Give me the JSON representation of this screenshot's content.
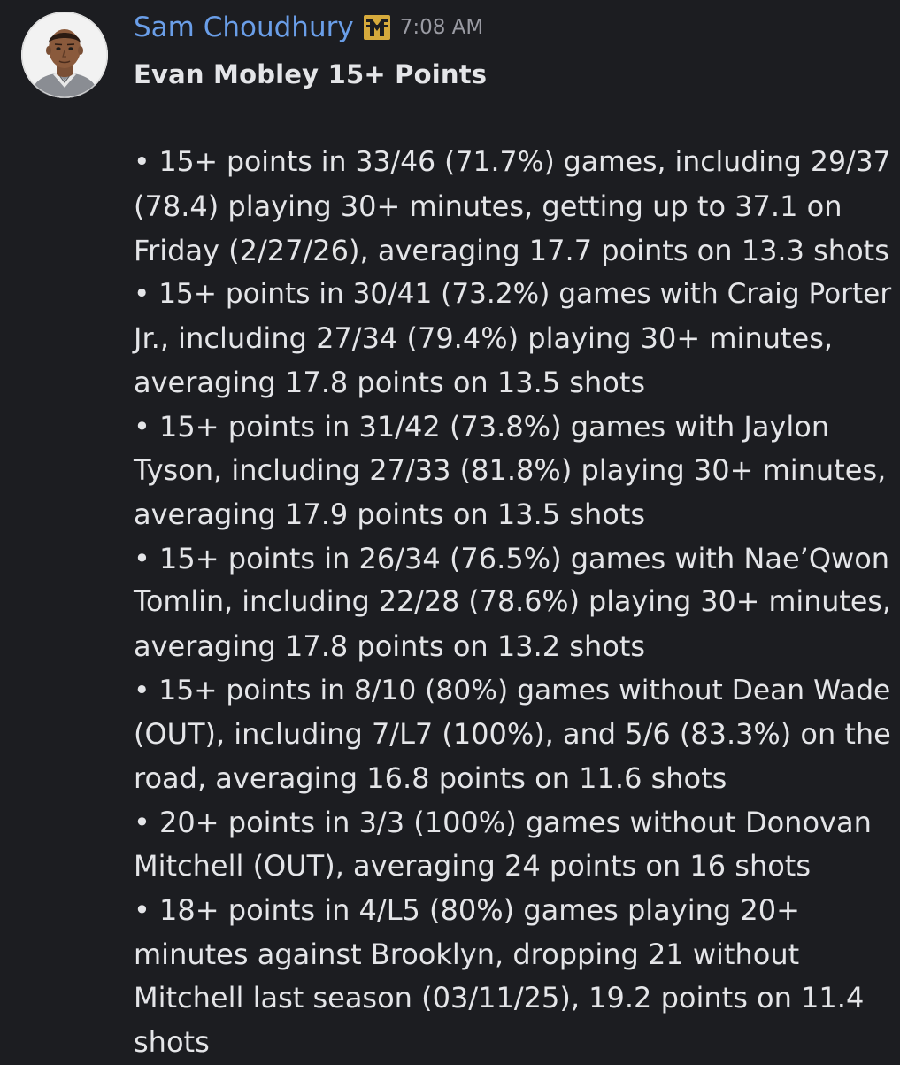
{
  "message": {
    "author": "Sam Choudhury",
    "timestamp": "7:08 AM",
    "role_icon": "guild-tag-icon",
    "title": "Evan Mobley 15+ Points",
    "lines": [
      "• 15+ points in 33/46 (71.7%) games, including 29/37",
      "(78.4) playing 30+ minutes, getting up to 37.1 on",
      "Friday (2/27/26), averaging 17.7 points on 13.3 shots",
      "• 15+ points in 30/41 (73.2%) games with Craig Porter",
      "Jr., including 27/34 (79.4%) playing 30+ minutes,",
      "averaging 17.8 points on 13.5 shots",
      "• 15+ points in 31/42 (73.8%) games with Jaylon",
      "Tyson, including 27/33 (81.8%) playing 30+ minutes,",
      "averaging 17.9 points on 13.5 shots",
      "• 15+ points in 26/34 (76.5%) games with Nae’Qwon",
      "Tomlin, including 22/28 (78.6%) playing 30+ minutes,",
      "averaging 17.8 points on 13.2 shots",
      "• 15+ points in 8/10 (80%) games without Dean Wade",
      "(OUT), including 7/L7 (100%), and 5/6 (83.3%) on the",
      "road, averaging 16.8 points on 11.6 shots",
      "• 20+ points in 3/3 (100%) games without Donovan",
      "Mitchell (OUT), averaging 24 points on 16 shots",
      "• 18+ points in 4/L5 (80%) games playing 20+",
      "minutes against Brooklyn, dropping 21 without",
      "Mitchell last season (03/11/25), 19.2 points on 11.4",
      "shots"
    ]
  },
  "colors": {
    "background": "#1c1d21",
    "username": "#6a9ee8",
    "text": "#e4e5e8",
    "timestamp": "#9a9ba3",
    "role_icon": "#d6aa3c"
  }
}
